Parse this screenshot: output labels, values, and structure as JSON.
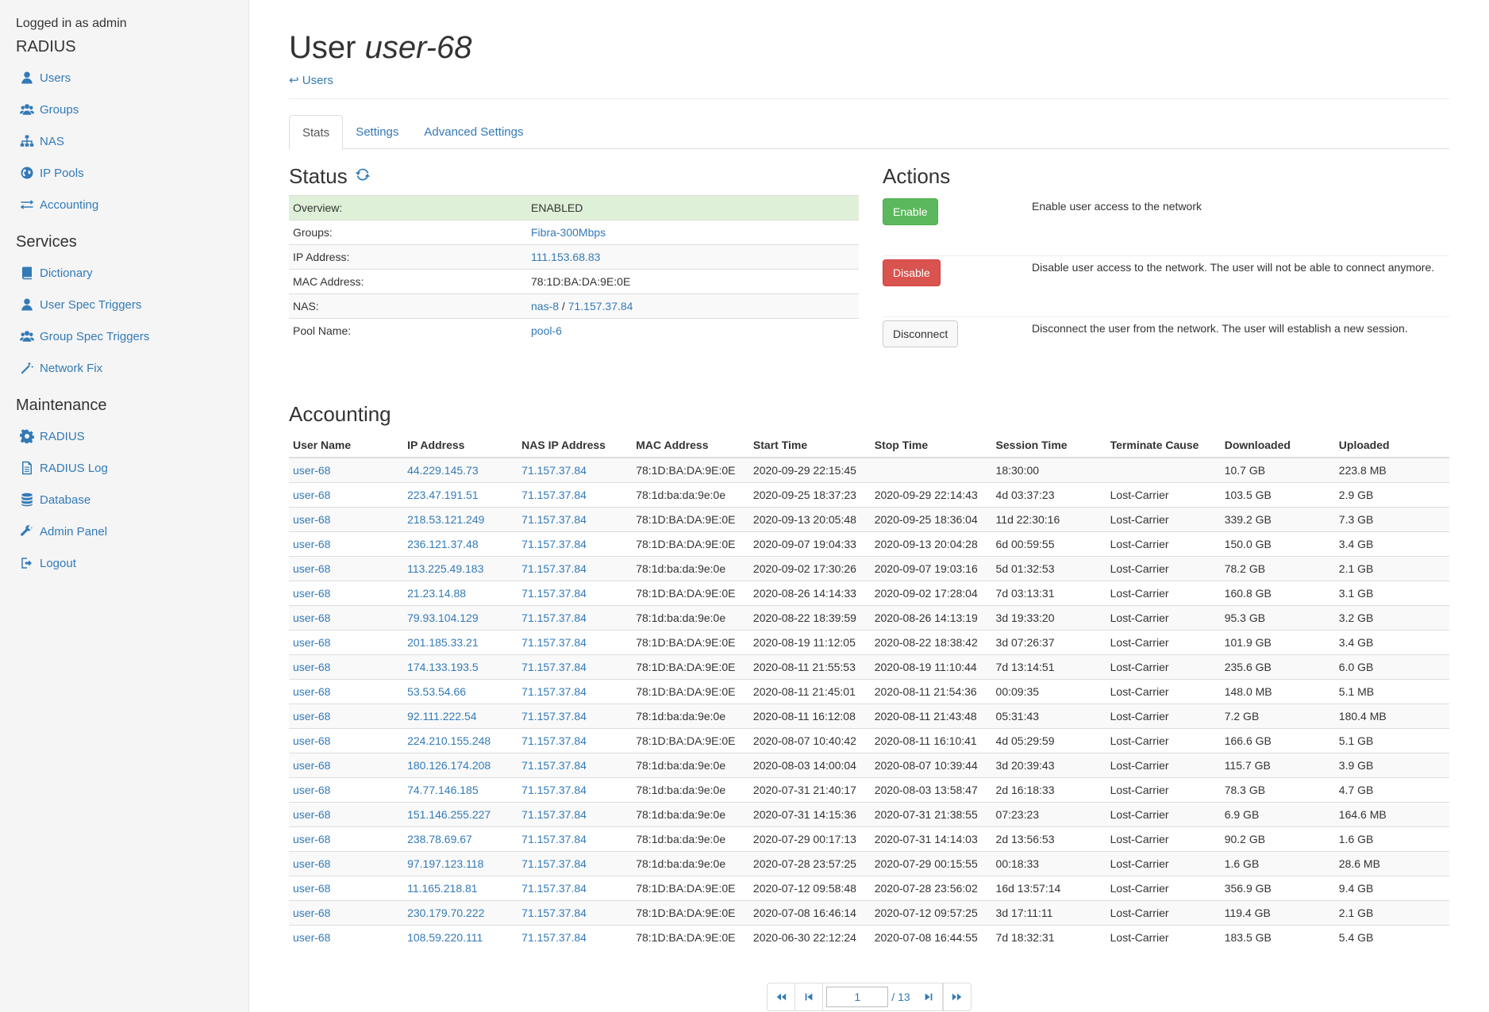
{
  "sidebar": {
    "logged_in": "Logged in as admin",
    "sections": [
      {
        "title": "RADIUS",
        "items": [
          {
            "label": "Users",
            "icon": "user-icon"
          },
          {
            "label": "Groups",
            "icon": "users-icon"
          },
          {
            "label": "NAS",
            "icon": "sitemap-icon"
          },
          {
            "label": "IP Pools",
            "icon": "globe-icon"
          },
          {
            "label": "Accounting",
            "icon": "exchange-icon"
          }
        ]
      },
      {
        "title": "Services",
        "items": [
          {
            "label": "Dictionary",
            "icon": "book-icon"
          },
          {
            "label": "User Spec Triggers",
            "icon": "user-icon"
          },
          {
            "label": "Group Spec Triggers",
            "icon": "users-icon"
          },
          {
            "label": "Network Fix",
            "icon": "magic-icon"
          }
        ]
      },
      {
        "title": "Maintenance",
        "items": [
          {
            "label": "RADIUS",
            "icon": "gear-icon"
          },
          {
            "label": "RADIUS Log",
            "icon": "file-icon"
          },
          {
            "label": "Database",
            "icon": "database-icon"
          },
          {
            "label": "Admin Panel",
            "icon": "wrench-icon"
          },
          {
            "label": "Logout",
            "icon": "logout-icon"
          }
        ]
      }
    ]
  },
  "page": {
    "title_prefix": "User",
    "title_user": "user-68",
    "back_link": "↩ Users"
  },
  "tabs": [
    {
      "label": "Stats",
      "active": true
    },
    {
      "label": "Settings",
      "active": false
    },
    {
      "label": "Advanced Settings",
      "active": false
    }
  ],
  "status": {
    "heading": "Status",
    "rows": [
      {
        "key": "Overview:",
        "value": "ENABLED",
        "link": false,
        "success": true
      },
      {
        "key": "Groups:",
        "value": "Fibra-300Mbps",
        "link": true
      },
      {
        "key": "IP Address:",
        "value": "111.153.68.83",
        "link": true
      },
      {
        "key": "MAC Address:",
        "value": "78:1D:BA:DA:9E:0E",
        "link": false
      },
      {
        "key": "NAS:",
        "value": "nas-8",
        "link": true,
        "sep": " / ",
        "value2": "71.157.37.84"
      },
      {
        "key": "Pool Name:",
        "value": "pool-6",
        "link": true
      }
    ]
  },
  "actions": {
    "heading": "Actions",
    "items": [
      {
        "label": "Enable",
        "style": "success",
        "desc": "Enable user access to the network"
      },
      {
        "label": "Disable",
        "style": "danger",
        "desc": "Disable user access to the network. The user will not be able to connect anymore."
      },
      {
        "label": "Disconnect",
        "style": "default",
        "desc": "Disconnect the user from the network. The user will establish a new session."
      }
    ]
  },
  "accounting": {
    "heading": "Accounting",
    "columns": [
      "User Name",
      "IP Address",
      "NAS IP Address",
      "MAC Address",
      "Start Time",
      "Stop Time",
      "Session Time",
      "Terminate Cause",
      "Downloaded",
      "Uploaded"
    ],
    "rows": [
      [
        "user-68",
        "44.229.145.73",
        "71.157.37.84",
        "78:1D:BA:DA:9E:0E",
        "2020-09-29 22:15:45",
        "",
        "18:30:00",
        "",
        "10.7 GB",
        "223.8 MB"
      ],
      [
        "user-68",
        "223.47.191.51",
        "71.157.37.84",
        "78:1d:ba:da:9e:0e",
        "2020-09-25 18:37:23",
        "2020-09-29 22:14:43",
        "4d 03:37:23",
        "Lost-Carrier",
        "103.5 GB",
        "2.9 GB"
      ],
      [
        "user-68",
        "218.53.121.249",
        "71.157.37.84",
        "78:1D:BA:DA:9E:0E",
        "2020-09-13 20:05:48",
        "2020-09-25 18:36:04",
        "11d 22:30:16",
        "Lost-Carrier",
        "339.2 GB",
        "7.3 GB"
      ],
      [
        "user-68",
        "236.121.37.48",
        "71.157.37.84",
        "78:1D:BA:DA:9E:0E",
        "2020-09-07 19:04:33",
        "2020-09-13 20:04:28",
        "6d 00:59:55",
        "Lost-Carrier",
        "150.0 GB",
        "3.4 GB"
      ],
      [
        "user-68",
        "113.225.49.183",
        "71.157.37.84",
        "78:1d:ba:da:9e:0e",
        "2020-09-02 17:30:26",
        "2020-09-07 19:03:16",
        "5d 01:32:53",
        "Lost-Carrier",
        "78.2 GB",
        "2.1 GB"
      ],
      [
        "user-68",
        "21.23.14.88",
        "71.157.37.84",
        "78:1D:BA:DA:9E:0E",
        "2020-08-26 14:14:33",
        "2020-09-02 17:28:04",
        "7d 03:13:31",
        "Lost-Carrier",
        "160.8 GB",
        "3.1 GB"
      ],
      [
        "user-68",
        "79.93.104.129",
        "71.157.37.84",
        "78:1d:ba:da:9e:0e",
        "2020-08-22 18:39:59",
        "2020-08-26 14:13:19",
        "3d 19:33:20",
        "Lost-Carrier",
        "95.3 GB",
        "3.2 GB"
      ],
      [
        "user-68",
        "201.185.33.21",
        "71.157.37.84",
        "78:1D:BA:DA:9E:0E",
        "2020-08-19 11:12:05",
        "2020-08-22 18:38:42",
        "3d 07:26:37",
        "Lost-Carrier",
        "101.9 GB",
        "3.4 GB"
      ],
      [
        "user-68",
        "174.133.193.5",
        "71.157.37.84",
        "78:1D:BA:DA:9E:0E",
        "2020-08-11 21:55:53",
        "2020-08-19 11:10:44",
        "7d 13:14:51",
        "Lost-Carrier",
        "235.6 GB",
        "6.0 GB"
      ],
      [
        "user-68",
        "53.53.54.66",
        "71.157.37.84",
        "78:1D:BA:DA:9E:0E",
        "2020-08-11 21:45:01",
        "2020-08-11 21:54:36",
        "00:09:35",
        "Lost-Carrier",
        "148.0 MB",
        "5.1 MB"
      ],
      [
        "user-68",
        "92.111.222.54",
        "71.157.37.84",
        "78:1d:ba:da:9e:0e",
        "2020-08-11 16:12:08",
        "2020-08-11 21:43:48",
        "05:31:43",
        "Lost-Carrier",
        "7.2 GB",
        "180.4 MB"
      ],
      [
        "user-68",
        "224.210.155.248",
        "71.157.37.84",
        "78:1D:BA:DA:9E:0E",
        "2020-08-07 10:40:42",
        "2020-08-11 16:10:41",
        "4d 05:29:59",
        "Lost-Carrier",
        "166.6 GB",
        "5.1 GB"
      ],
      [
        "user-68",
        "180.126.174.208",
        "71.157.37.84",
        "78:1d:ba:da:9e:0e",
        "2020-08-03 14:00:04",
        "2020-08-07 10:39:44",
        "3d 20:39:43",
        "Lost-Carrier",
        "115.7 GB",
        "3.9 GB"
      ],
      [
        "user-68",
        "74.77.146.185",
        "71.157.37.84",
        "78:1d:ba:da:9e:0e",
        "2020-07-31 21:40:17",
        "2020-08-03 13:58:47",
        "2d 16:18:33",
        "Lost-Carrier",
        "78.3 GB",
        "4.7 GB"
      ],
      [
        "user-68",
        "151.146.255.227",
        "71.157.37.84",
        "78:1d:ba:da:9e:0e",
        "2020-07-31 14:15:36",
        "2020-07-31 21:38:55",
        "07:23:23",
        "Lost-Carrier",
        "6.9 GB",
        "164.6 MB"
      ],
      [
        "user-68",
        "238.78.69.67",
        "71.157.37.84",
        "78:1d:ba:da:9e:0e",
        "2020-07-29 00:17:13",
        "2020-07-31 14:14:03",
        "2d 13:56:53",
        "Lost-Carrier",
        "90.2 GB",
        "1.6 GB"
      ],
      [
        "user-68",
        "97.197.123.118",
        "71.157.37.84",
        "78:1d:ba:da:9e:0e",
        "2020-07-28 23:57:25",
        "2020-07-29 00:15:55",
        "00:18:33",
        "Lost-Carrier",
        "1.6 GB",
        "28.6 MB"
      ],
      [
        "user-68",
        "11.165.218.81",
        "71.157.37.84",
        "78:1D:BA:DA:9E:0E",
        "2020-07-12 09:58:48",
        "2020-07-28 23:56:02",
        "16d 13:57:14",
        "Lost-Carrier",
        "356.9 GB",
        "9.4 GB"
      ],
      [
        "user-68",
        "230.179.70.222",
        "71.157.37.84",
        "78:1D:BA:DA:9E:0E",
        "2020-07-08 16:46:14",
        "2020-07-12 09:57:25",
        "3d 17:11:11",
        "Lost-Carrier",
        "119.4 GB",
        "2.1 GB"
      ],
      [
        "user-68",
        "108.59.220.111",
        "71.157.37.84",
        "78:1D:BA:DA:9E:0E",
        "2020-06-30 22:12:24",
        "2020-07-08 16:44:55",
        "7d 18:32:31",
        "Lost-Carrier",
        "183.5 GB",
        "5.4 GB"
      ]
    ]
  },
  "pagination": {
    "current": "1",
    "total_text": "/ 13"
  }
}
